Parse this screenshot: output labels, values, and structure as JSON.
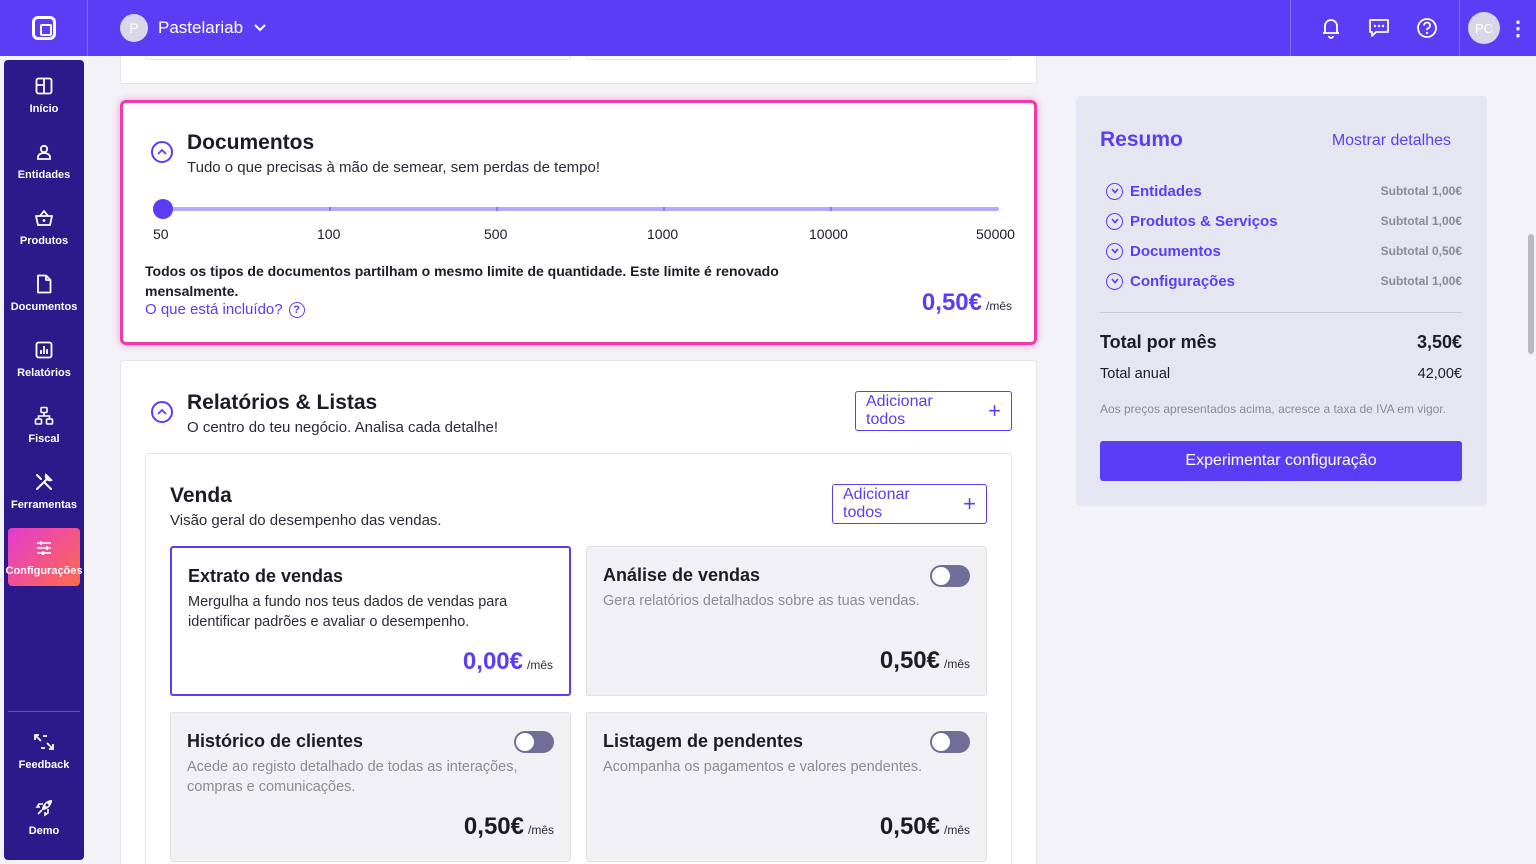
{
  "topbar": {
    "org_initial": "P",
    "org_name": "Pastelariab",
    "user_initials": "PC"
  },
  "sidebar": {
    "items": [
      {
        "label": "Início",
        "icon": "dashboard-icon"
      },
      {
        "label": "Entidades",
        "icon": "user-icon"
      },
      {
        "label": "Produtos",
        "icon": "basket-icon"
      },
      {
        "label": "Documentos",
        "icon": "document-icon"
      },
      {
        "label": "Relatórios",
        "icon": "chart-icon"
      },
      {
        "label": "Fiscal",
        "icon": "fiscal-icon"
      },
      {
        "label": "Ferramentas",
        "icon": "tools-icon"
      },
      {
        "label": "Configurações",
        "icon": "settings-sliders-icon"
      }
    ],
    "footer": [
      {
        "label": "Feedback",
        "icon": "feedback-icon"
      },
      {
        "label": "Demo",
        "icon": "rocket-icon"
      }
    ],
    "active_item": "Configurações"
  },
  "documentos": {
    "title": "Documentos",
    "subtitle": "Tudo o que precisas à mão de semear, sem perdas de tempo!",
    "slider_labels": [
      "50",
      "100",
      "500",
      "1000",
      "10000",
      "50000"
    ],
    "slider_selected": "50",
    "note": "Todos os tipos de documentos partilham o mesmo limite de quantidade. Este limite é renovado mensalmente.",
    "link": "O que está incluído?",
    "price": "0,50€",
    "price_unit": "/mês"
  },
  "relatorios": {
    "title": "Relatórios & Listas",
    "subtitle": "O centro do teu negócio. Analisa cada detalhe!",
    "add_all": "Adicionar todos",
    "venda": {
      "title": "Venda",
      "subtitle": "Visão geral do desempenho das vendas.",
      "add_all": "Adicionar todos",
      "items": [
        {
          "title": "Extrato de vendas",
          "desc": "Mergulha a fundo nos teus dados de vendas para identificar padrões e avaliar o desempenho.",
          "price": "0,00€",
          "unit": "/mês",
          "selected": true
        },
        {
          "title": "Análise de vendas",
          "desc": "Gera relatórios detalhados sobre as tuas vendas.",
          "price": "0,50€",
          "unit": "/mês",
          "enabled": false
        },
        {
          "title": "Histórico de clientes",
          "desc": "Acede ao registo detalhado de todas as interações, compras e comunicações.",
          "price": "0,50€",
          "unit": "/mês",
          "enabled": false
        },
        {
          "title": "Listagem de pendentes",
          "desc": "Acompanha os pagamentos e valores pendentes.",
          "price": "0,50€",
          "unit": "/mês",
          "enabled": false
        }
      ]
    }
  },
  "summary": {
    "title": "Resumo",
    "details_link": "Mostrar detalhes",
    "rows": [
      {
        "label": "Entidades",
        "subtotal": "Subtotal 1,00€"
      },
      {
        "label": "Produtos & Serviços",
        "subtotal": "Subtotal 1,00€"
      },
      {
        "label": "Documentos",
        "subtotal": "Subtotal 0,50€"
      },
      {
        "label": "Configurações",
        "subtotal": "Subtotal 1,00€"
      }
    ],
    "total_label": "Total por mês",
    "total_value": "3,50€",
    "annual_label": "Total anual",
    "annual_value": "42,00€",
    "note": "Aos preços apresentados acima, acresce a taxa de IVA em vigor.",
    "cta": "Experimentar configuração"
  },
  "colors": {
    "brand": "#5b3df5",
    "sidebar": "#2d1a8a",
    "highlight_border": "#f03aa8"
  }
}
